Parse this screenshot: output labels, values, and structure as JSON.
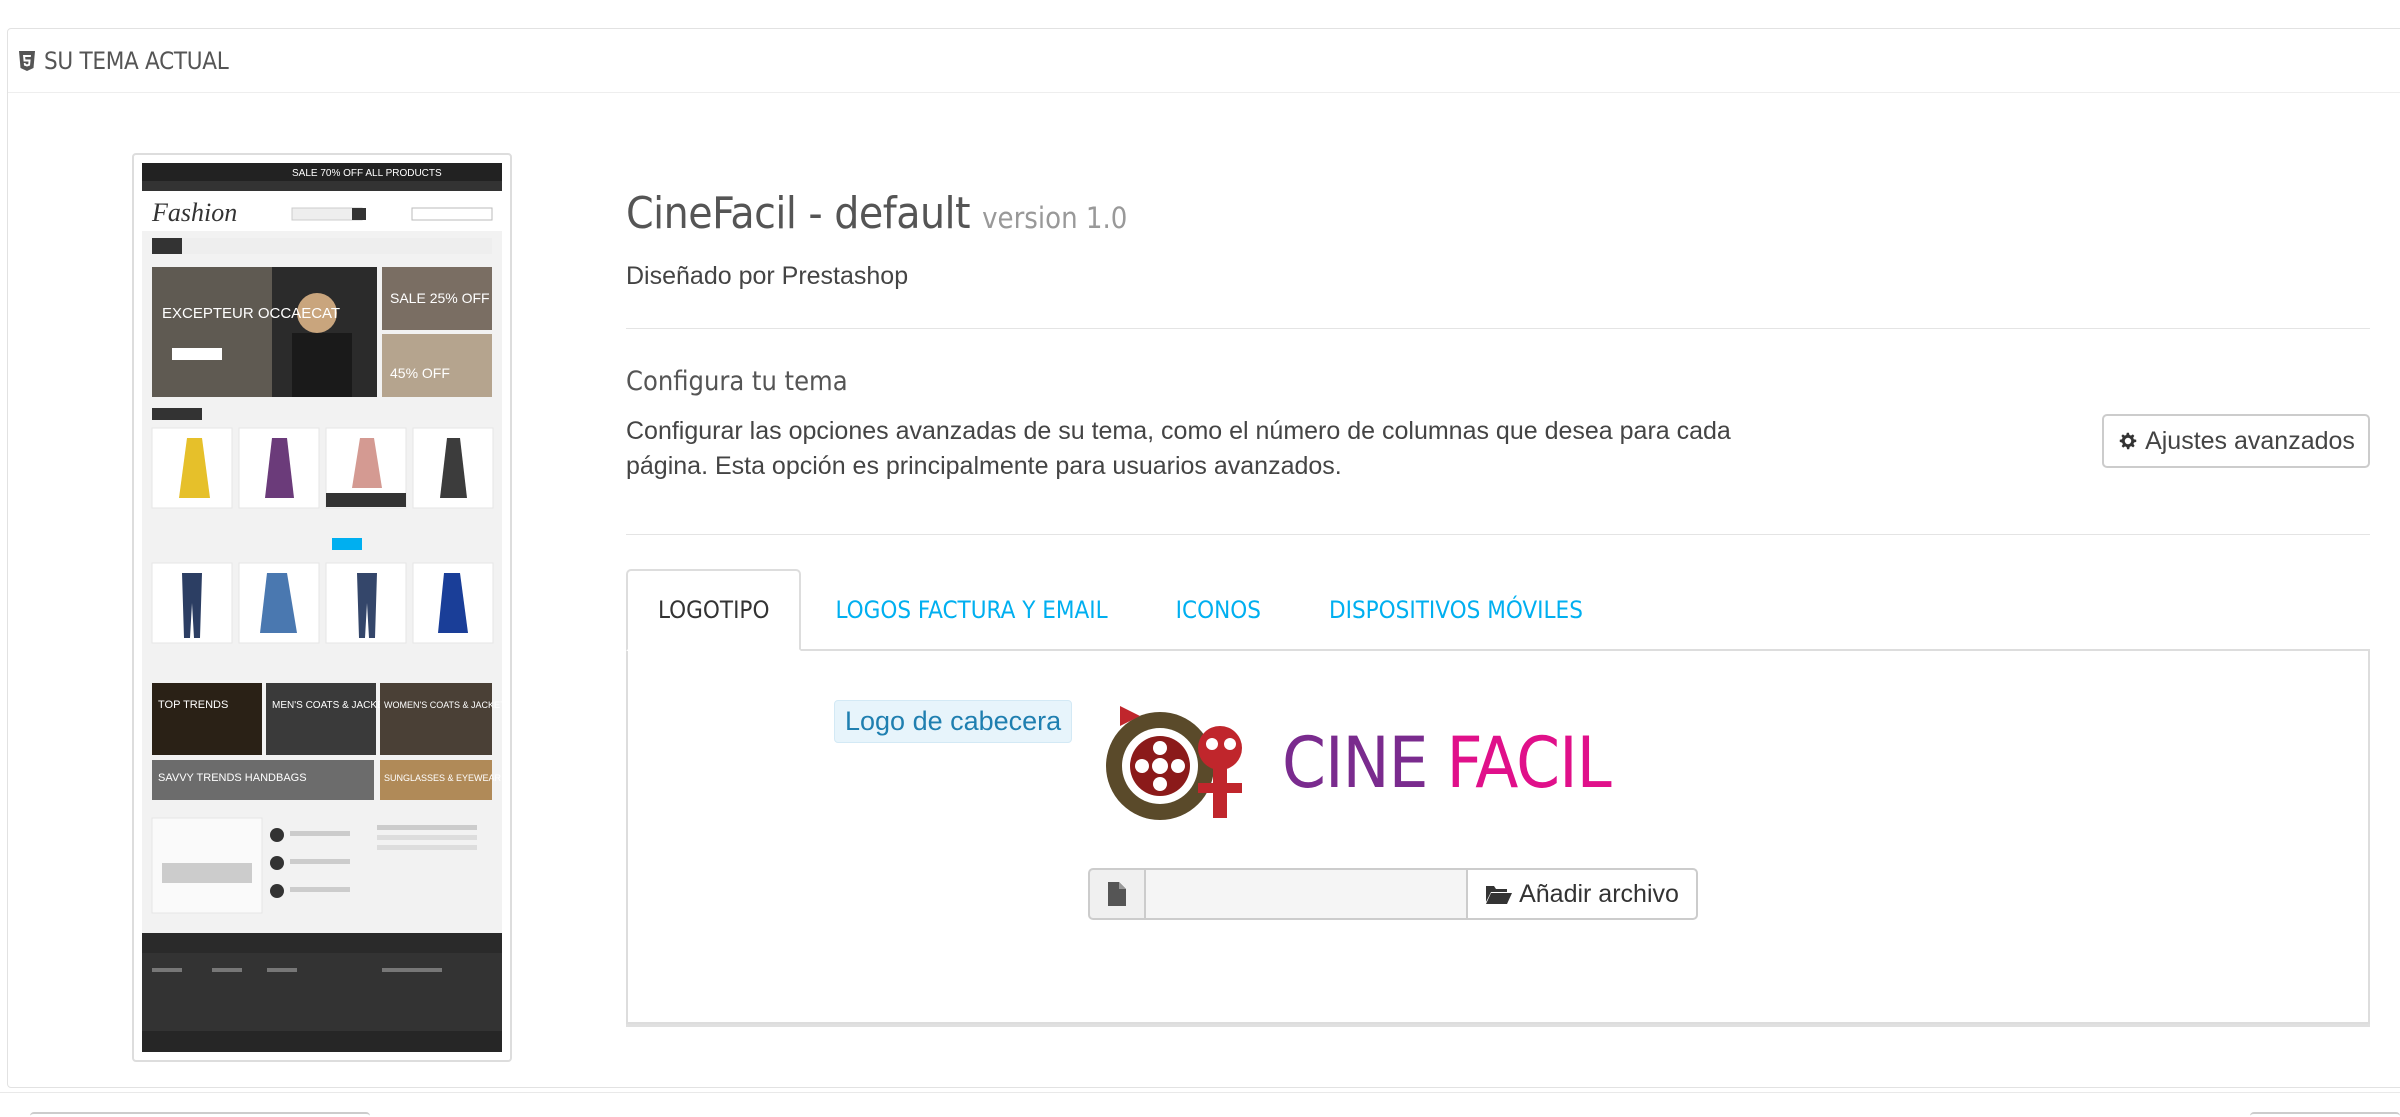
{
  "panel": {
    "heading": "SU TEMA ACTUAL",
    "heading_icon": "html5-icon"
  },
  "preview": {
    "image_name": "theme-preview",
    "banner_text": "SALE 70% OFF ALL PRODUCTS",
    "brand_text": "Fashion",
    "hero_text": "EXCEPTEUR OCCAECAT",
    "promo_1": "SALE 25% OFF",
    "promo_2": "45% OFF",
    "tiles": [
      "TOP TRENDS",
      "MEN'S COATS & JACKETS",
      "WOMEN'S COATS & JACKETS",
      "SAVVY TRENDS HANDBAGS",
      "SUNGLASSES & EYEWEAR"
    ]
  },
  "theme": {
    "name": "CineFacil - default",
    "version": "version 1.0",
    "designer": "Diseñado por Prestashop"
  },
  "config": {
    "title": "Configura tu tema",
    "description": "Configurar las opciones avanzadas de su tema, como el número de columnas que desea para cada página. Esta opción es principalmente para usuarios avanzados.",
    "button_label": "Ajustes avanzados",
    "button_icon": "gear-icon"
  },
  "tabs": [
    {
      "label": "LOGOTIPO",
      "active": true
    },
    {
      "label": "LOGOS FACTURA Y EMAIL",
      "active": false
    },
    {
      "label": "ICONOS",
      "active": false
    },
    {
      "label": "DISPOSITIVOS MÓVILES",
      "active": false
    }
  ],
  "logo_tab": {
    "label": "Logo de cabecera",
    "logo_word_1": "CINE",
    "logo_word_2": "FACIL",
    "file_value": "",
    "upload_label": "Añadir archivo",
    "file_icon": "file-icon",
    "upload_icon": "folder-open-icon"
  },
  "colors": {
    "accent": "#00aff0",
    "logo_purple": "#7a2b8e",
    "logo_magenta": "#e0108a"
  }
}
